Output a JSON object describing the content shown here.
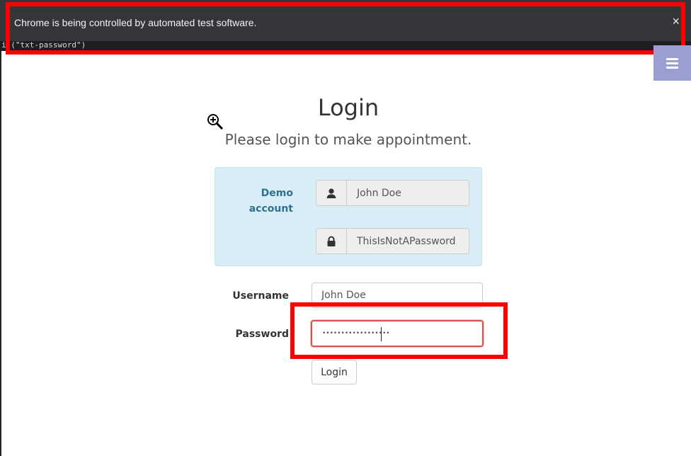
{
  "infobar": {
    "message": "Chrome is being controlled by automated test software.",
    "close_glyph": "×"
  },
  "terminal_snippet": "i (\"txt-password\")",
  "nav": {
    "menu_icon": "hamburger-icon",
    "menu_color": "#9b9ed0"
  },
  "page": {
    "title": "Login",
    "subtitle": "Please login to make appointment."
  },
  "demo": {
    "label": "Demo account",
    "username": "John Doe",
    "password": "ThisIsNotAPassword",
    "user_icon": "user-icon",
    "lock_icon": "lock-icon"
  },
  "form": {
    "username_label": "Username",
    "username_value": "John Doe",
    "password_label": "Password",
    "password_masked": "••••••••••••••••••",
    "login_button": "Login"
  },
  "highlight_color": "#ff0000"
}
